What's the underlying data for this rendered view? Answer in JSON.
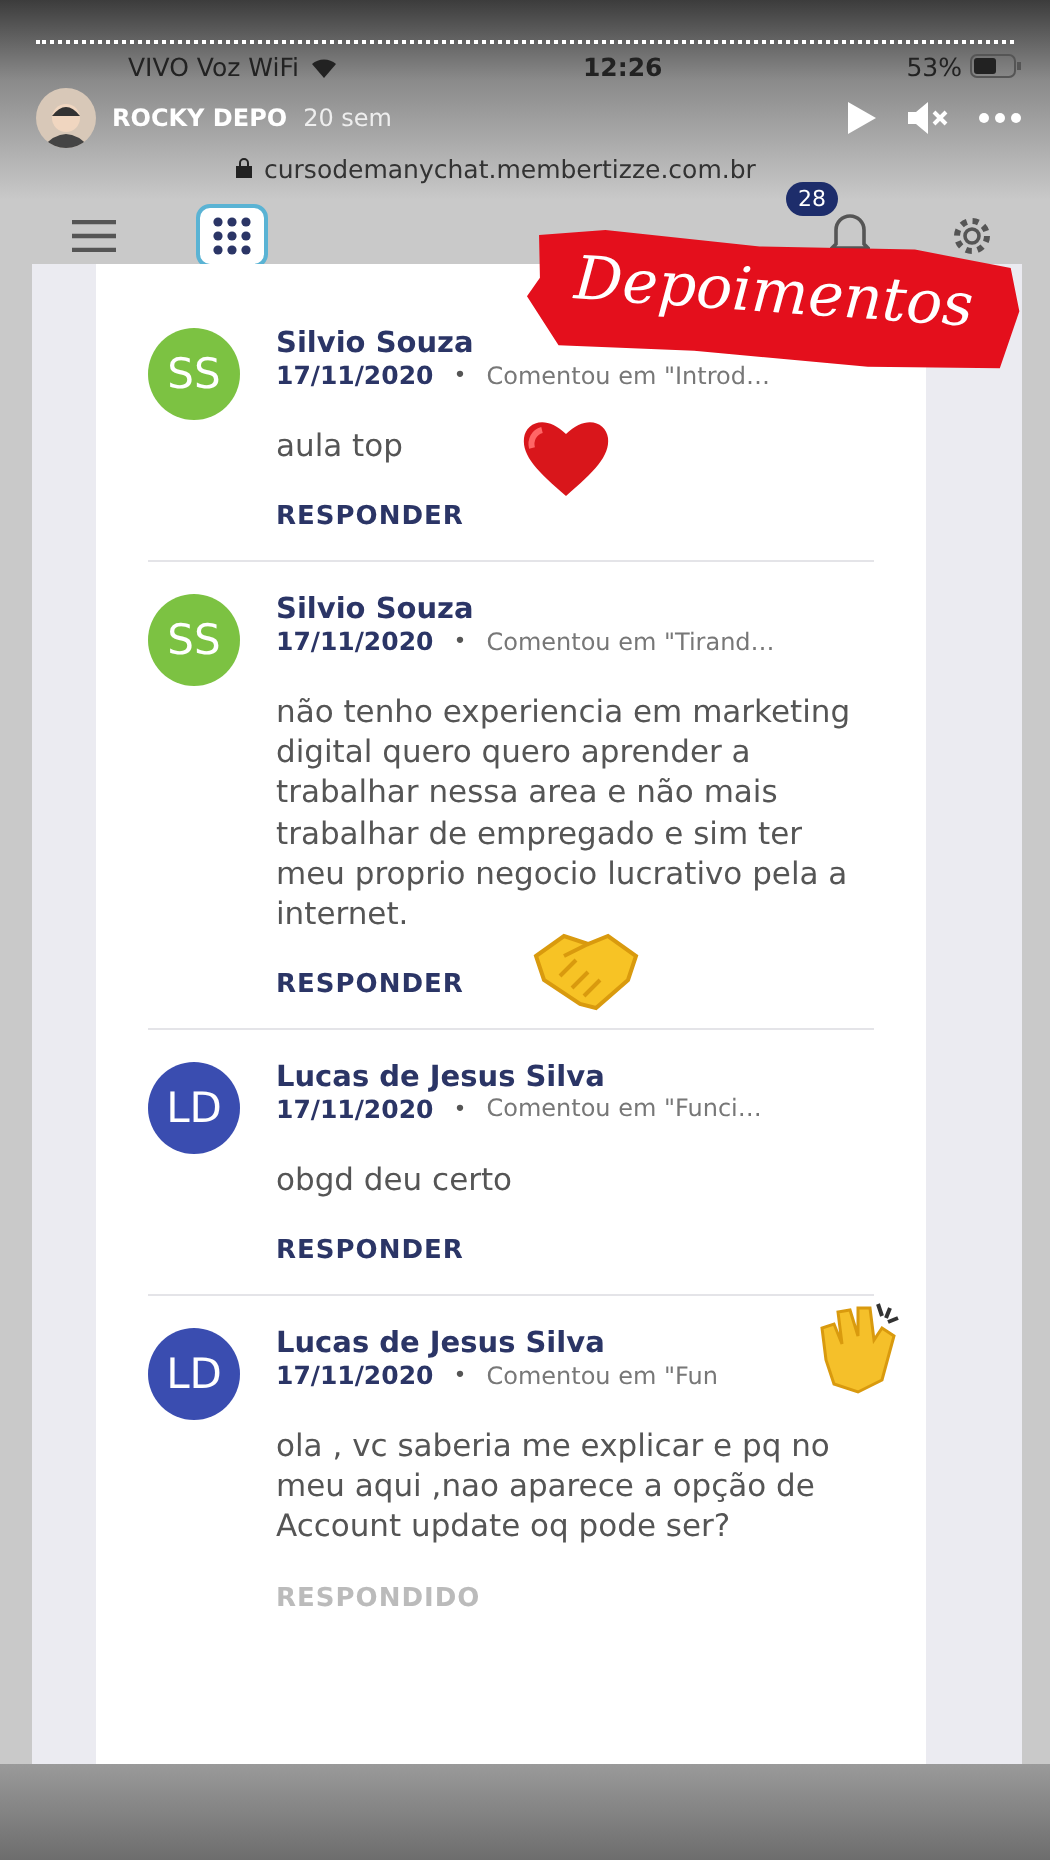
{
  "story": {
    "author": "ROCKY DEPO",
    "age": "20 sem"
  },
  "phone_status": {
    "carrier": "VIVO Voz WiFi",
    "time": "12:26",
    "battery": "53%"
  },
  "address_bar": {
    "url": "cursodemanychat.membertizze.com.br"
  },
  "app_header": {
    "notification_count": "28"
  },
  "sticker": {
    "text": "Depoimentos"
  },
  "comments": [
    {
      "initials": "SS",
      "color": "#7cc242",
      "name": "Silvio Souza",
      "date": "17/11/2020",
      "separator": "•",
      "context": "Comentou em \"Introd…",
      "body": "aula top",
      "action": "RESPONDER",
      "answered": false,
      "emoji": {
        "kind": "heart"
      }
    },
    {
      "initials": "SS",
      "color": "#7cc242",
      "name": "Silvio Souza",
      "date": "17/11/2020",
      "separator": "•",
      "context": "Comentou em \"Tirand…",
      "body": "não tenho experiencia em marketing digital quero quero aprender a trabalhar nessa area e não mais trabalhar de empregado e sim ter meu proprio negocio lucrativo pela a internet.",
      "action": "RESPONDER",
      "answered": false,
      "emoji": {
        "kind": "handshake"
      }
    },
    {
      "initials": "LD",
      "color": "#3a4db0",
      "name": "Lucas de Jesus Silva",
      "date": "17/11/2020",
      "separator": "•",
      "context": "Comentou em \"Funci…",
      "body": "obgd deu certo",
      "action": "RESPONDER",
      "answered": false
    },
    {
      "initials": "LD",
      "color": "#3a4db0",
      "name": "Lucas de Jesus Silva",
      "date": "17/11/2020",
      "separator": "•",
      "context": "Comentou em \"Fun",
      "body": "ola , vc saberia me explicar e pq no meu aqui ,nao aparece a opção de Account update oq pode ser?",
      "action": "RESPONDIDO",
      "answered": true,
      "emoji": {
        "kind": "clap"
      }
    }
  ]
}
